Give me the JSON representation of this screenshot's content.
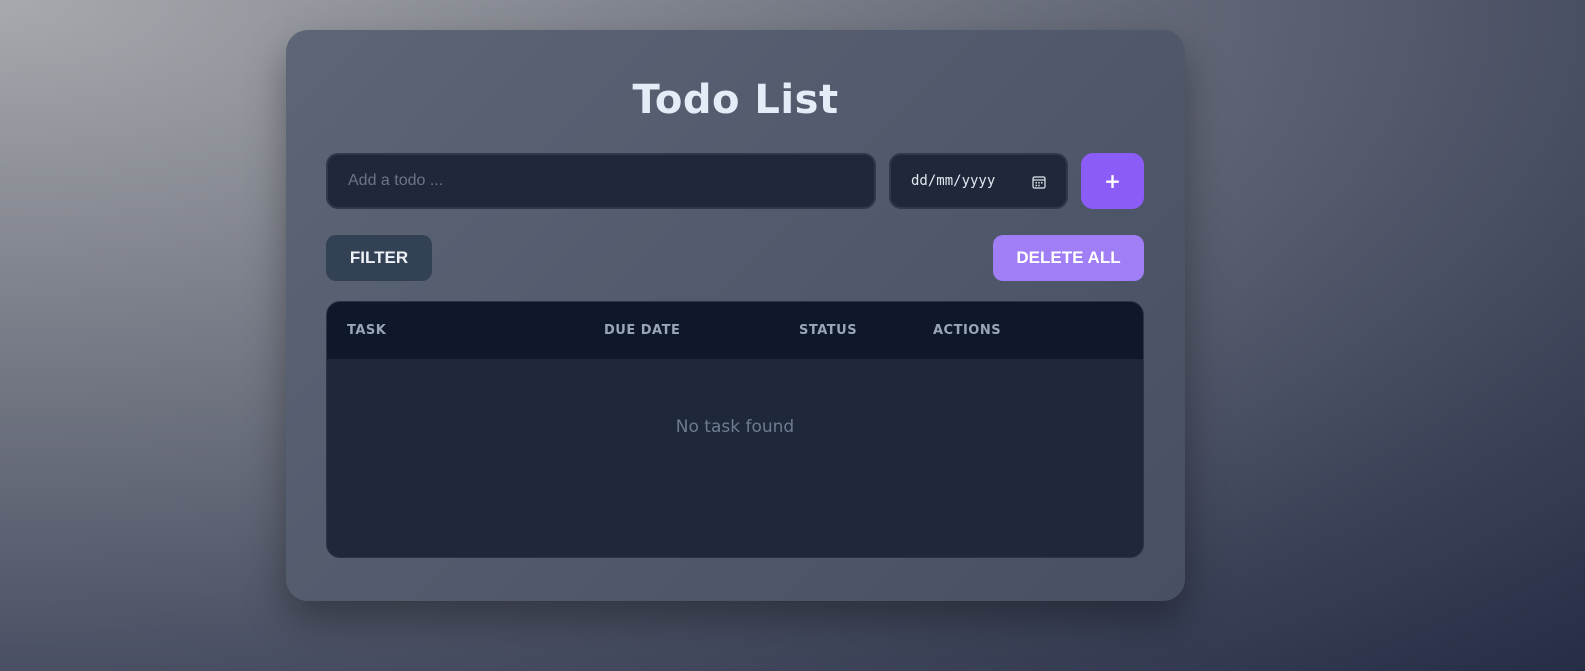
{
  "app": {
    "title": "Todo List"
  },
  "add_form": {
    "todo_placeholder": "Add a todo ...",
    "date_placeholder": "dd/mm/yyyy",
    "add_label": "+"
  },
  "toolbar": {
    "filter_label": "FILTER",
    "delete_all_label": "DELETE ALL"
  },
  "table": {
    "columns": [
      "TASK",
      "DUE DATE",
      "STATUS",
      "ACTIONS"
    ],
    "rows": [],
    "empty_message": "No task found"
  },
  "icons": {
    "date_picker": "calendar-icon"
  },
  "colors": {
    "accent": "#8b5cf6",
    "accent_light": "#a07ef6",
    "panel": "#1e283a",
    "header": "#0f172a"
  }
}
